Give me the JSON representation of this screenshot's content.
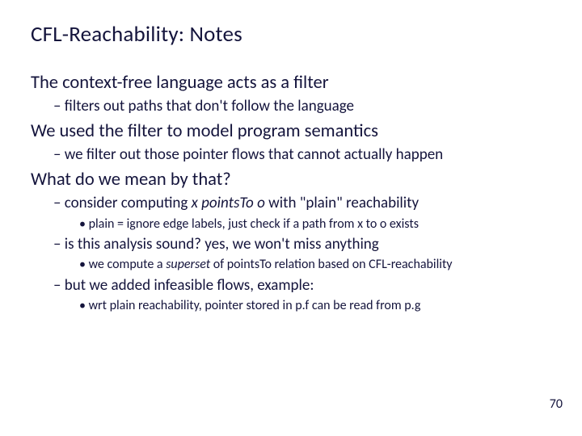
{
  "title": "CFL-Reachability:  Notes",
  "b1": "The context-free language acts as a filter",
  "b1a": "filters out paths that don't follow the language",
  "b2": "We used the filter to model program semantics",
  "b2a": "we filter out those pointer flows that cannot actually happen",
  "b3": "What do we mean by that?",
  "b3a_pre": "consider computing ",
  "b3a_it": "x pointsTo o",
  "b3a_post": " with \"plain\" reachability",
  "b3a1": "plain = ignore edge labels, just check if a path from x to o exists",
  "b3b": "is this analysis sound?  yes, we won't miss anything",
  "b3b1_pre": "we compute a ",
  "b3b1_it": "superset",
  "b3b1_post": " of pointsTo relation based on CFL-reachability",
  "b3c": "but we added infeasible flows, example:",
  "b3c1": "wrt  plain reachability, pointer stored in p.f can be read from p.g",
  "slidenum": "70"
}
